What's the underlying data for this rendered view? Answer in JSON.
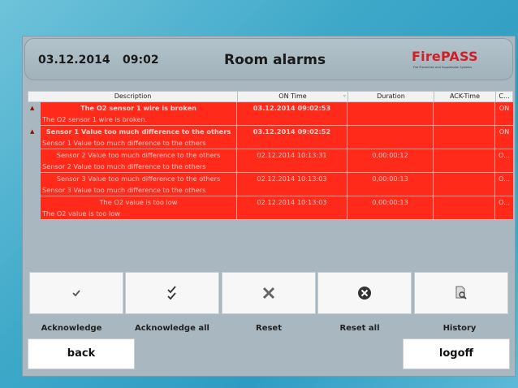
{
  "header": {
    "date": "03.12.2014",
    "time": "09:02",
    "title": "Room alarms",
    "logo_text": "FirePASS",
    "logo_sub": "Fire Prevention and Suppression Systems"
  },
  "table": {
    "columns": [
      "Description",
      "ON Time",
      "Duration",
      "ACK-Time",
      "C..."
    ],
    "rows": [
      {
        "title": "The O2 sensor 1 wire is broken",
        "desc": "The O2 sensor 1 wire is broken.",
        "on_time": "03.12.2014 09:02:53",
        "duration": "",
        "ack_time": "",
        "state": "ON",
        "active": true
      },
      {
        "title": "Sensor 1 Value too much difference to the others",
        "desc": "Sensor 1 Value too much difference to the others",
        "on_time": "03.12.2014 09:02:52",
        "duration": "",
        "ack_time": "",
        "state": "ON",
        "active": true
      },
      {
        "title": "Sensor 2 Value too much difference to the others",
        "desc": "Sensor 2 Value too much difference to the others",
        "on_time": "02.12.2014 10:13:31",
        "duration": "0,00:00:12",
        "ack_time": "",
        "state": "O...",
        "active": false
      },
      {
        "title": "Sensor 3 Value too much difference to the others",
        "desc": "Sensor 3 Value too much difference to the others",
        "on_time": "02.12.2014 10:13:03",
        "duration": "0,00:00:13",
        "ack_time": "",
        "state": "O...",
        "active": false
      },
      {
        "title": "The O2 value is too low",
        "desc": "The O2 value is too low",
        "on_time": "02.12.2014 10:13:03",
        "duration": "0,00:00:13",
        "ack_time": "",
        "state": "O...",
        "active": false
      }
    ]
  },
  "buttons": {
    "acknowledge": "Acknowledge",
    "acknowledge_all": "Acknowledge all",
    "reset": "Reset",
    "reset_all": "Reset all",
    "history": "History",
    "back": "back",
    "logoff": "logoff"
  },
  "colors": {
    "alarm_row": "#ff2a1a",
    "logo_red": "#d11f25"
  }
}
